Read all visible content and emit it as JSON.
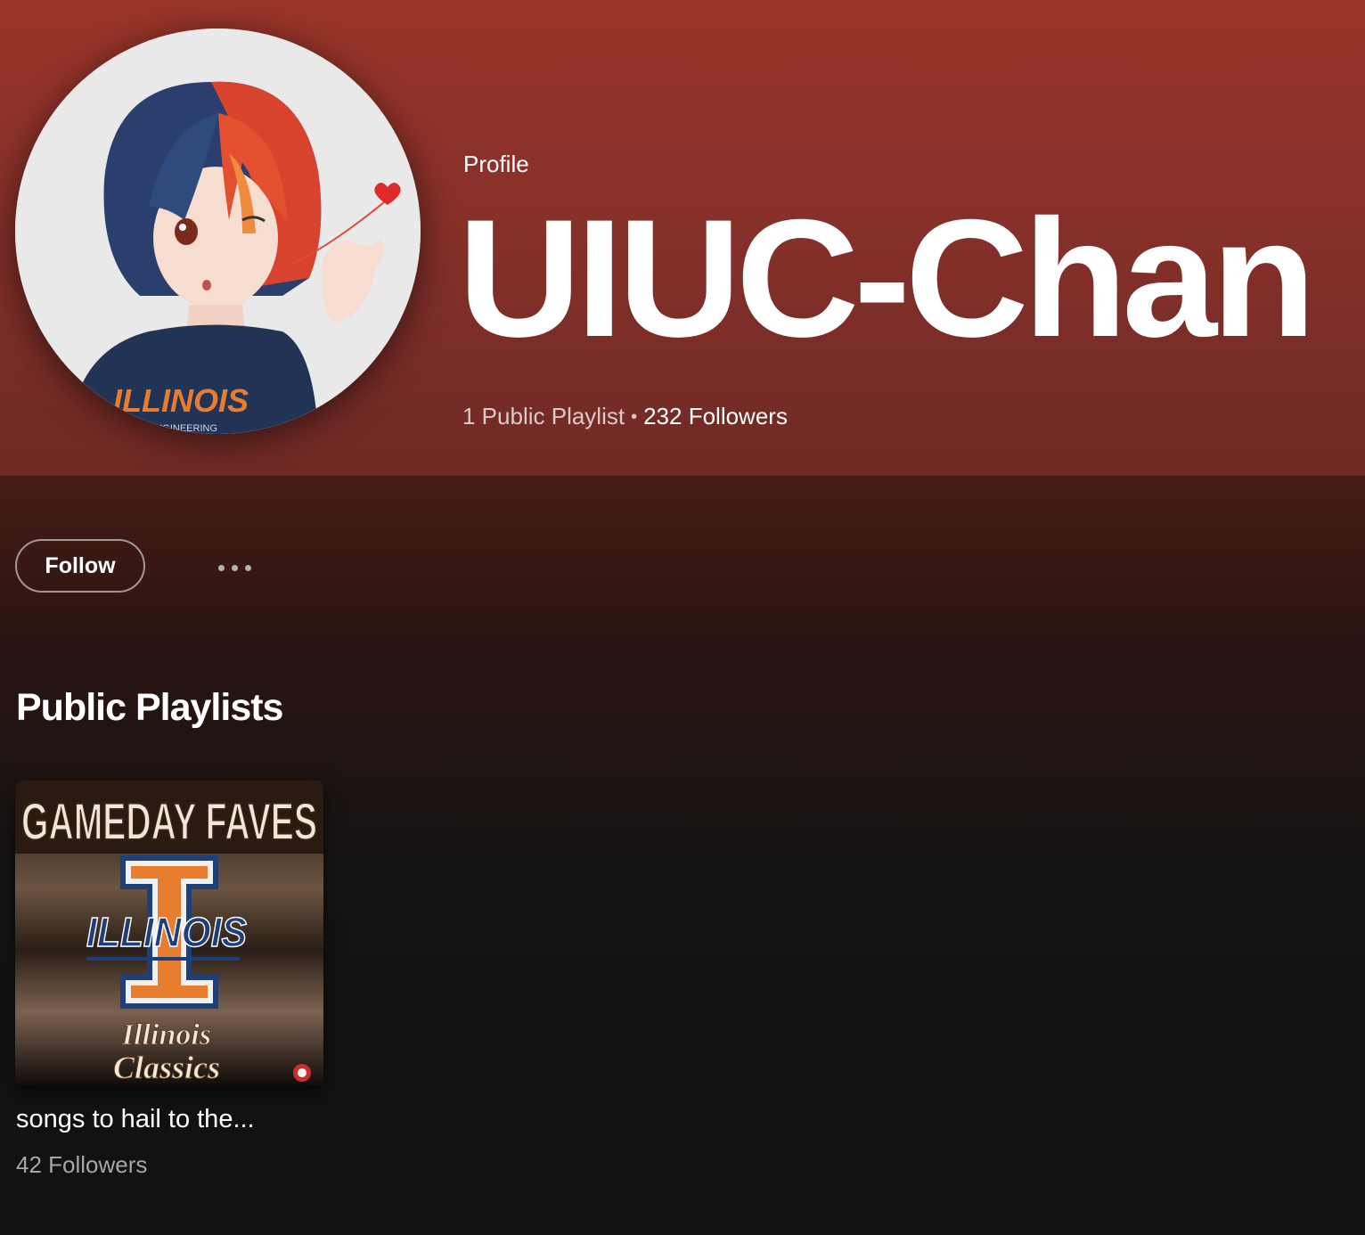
{
  "profile": {
    "type_label": "Profile",
    "name": "UIUC-Chan",
    "playlist_count": "1 Public Playlist",
    "separator": "•",
    "followers": "232 Followers",
    "avatar_shirt_text": "ILLINOIS",
    "avatar_shirt_sub": "ENGINEERING"
  },
  "actions": {
    "follow_label": "Follow",
    "more_icon": "more-options-icon"
  },
  "section": {
    "title": "Public Playlists"
  },
  "playlists": [
    {
      "title": "songs to hail to the...",
      "subtitle": "42 Followers",
      "cover_header": "GAMEDAY FAVES",
      "cover_band": "ILLINOIS",
      "cover_script_1": "Illinois",
      "cover_script_2": "Classics"
    }
  ],
  "colors": {
    "hero_top": "#9a3529",
    "hero_bottom": "#6f2a24",
    "background": "#121212",
    "illinois_orange": "#e87d2f",
    "illinois_blue": "#1f3f7a"
  }
}
